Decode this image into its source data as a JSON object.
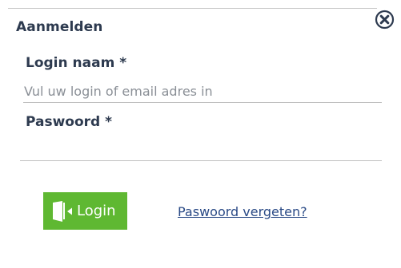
{
  "dialog": {
    "title": "Aanmelden",
    "close_icon": "close-circle-icon"
  },
  "form": {
    "login": {
      "label": "Login naam *",
      "placeholder": "Vul uw login of email adres in",
      "value": ""
    },
    "password": {
      "label": "Paswoord *",
      "placeholder": "",
      "value": ""
    }
  },
  "actions": {
    "login_label": "Login",
    "login_icon": "door-enter-icon",
    "forgot_label": "Paswoord vergeten?"
  },
  "colors": {
    "accent_green": "#5fb832",
    "text_dark": "#2d3a4f",
    "link_blue": "#2a4a86"
  }
}
